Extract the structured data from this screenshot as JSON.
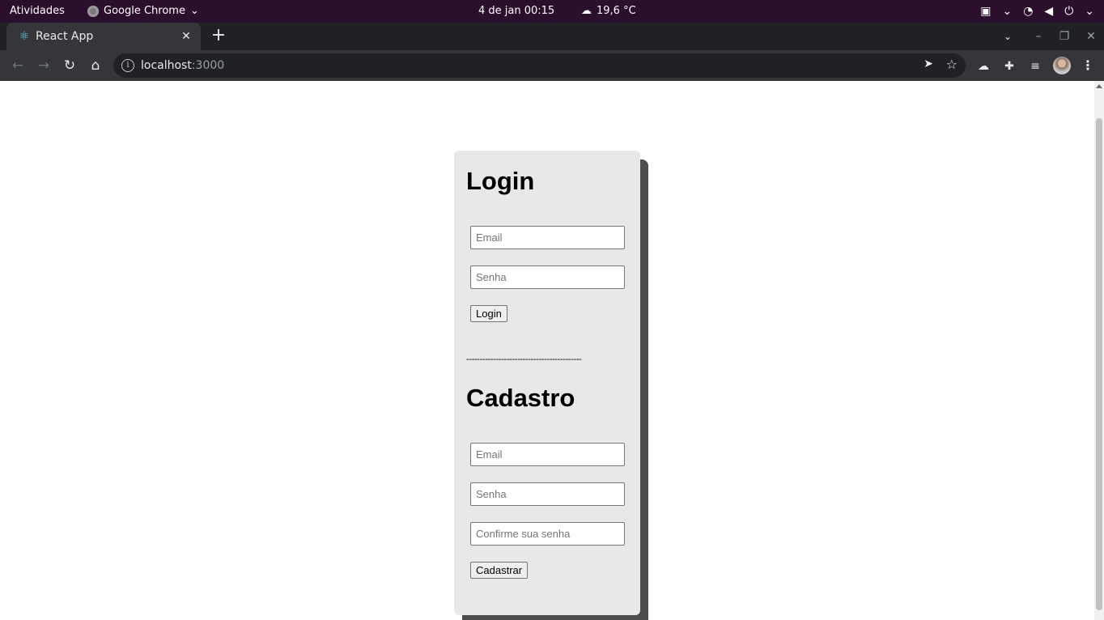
{
  "topbar": {
    "activities": "Atividades",
    "app_name": "Google Chrome",
    "clock": "4 de jan  00:15",
    "weather": "19,6 °C"
  },
  "browser": {
    "tab_title": "React App",
    "url_host": "localhost",
    "url_port": ":3000"
  },
  "page": {
    "login": {
      "title": "Login",
      "email_placeholder": "Email",
      "password_placeholder": "Senha",
      "button": "Login"
    },
    "divider": "-------------------------------------------",
    "signup": {
      "title": "Cadastro",
      "email_placeholder": "Email",
      "password_placeholder": "Senha",
      "confirm_placeholder": "Confirme sua senha",
      "button": "Cadastrar"
    }
  }
}
